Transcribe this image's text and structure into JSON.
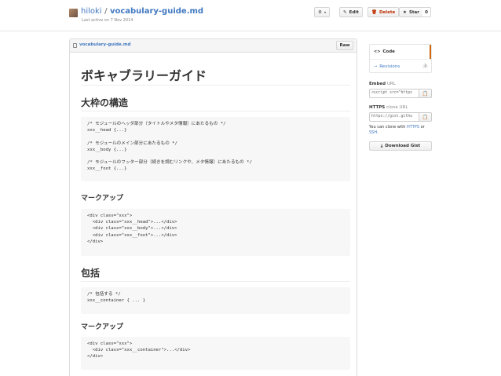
{
  "header": {
    "user": "hiloki",
    "separator": "/",
    "gist_name": "vocabulary-guide.md",
    "meta": "Last active on 7 Nov 2014",
    "edit_label": "Edit",
    "delete_label": "Delete",
    "star_label": "Star",
    "star_count": "0"
  },
  "file": {
    "name": "vocabulary-guide.md",
    "raw_label": "Raw"
  },
  "doc": {
    "title": "ボキャブラリーガイド",
    "section1": "大枠の構造",
    "code1": [
      "/* モジュールのヘッダ部分（タイトルやメタ情報）にあたるもの */",
      "xxx__head {...}",
      "",
      "/* モジュールのメイン部分にあたるもの */",
      "xxx__body {...}",
      "",
      "/* モジュールのフッター部分（続きを読むリンクや、メタ情報）にあたるもの */",
      "xxx__foot {...}"
    ],
    "markup1": "マークアップ",
    "code2": [
      "<div class=\"xxx\">",
      "  <div class=\"xxx__head\">...</div>",
      "  <div class=\"xxx__body\">...</div>",
      "  <div class=\"xxx__foot\">...</div>",
      "</div>"
    ],
    "section2": "包括",
    "code3": [
      "/* 包括する */",
      "xxx__container { ... }"
    ],
    "markup2": "マークアップ",
    "code4": [
      "<div class=\"xxx\">",
      "  <div class=\"xxx__container\">...</div>",
      "</div>"
    ]
  },
  "sidebar": {
    "code_label": "Code",
    "revisions_label": "Revisions",
    "revisions_count": "3",
    "embed_label": "Embed",
    "embed_suffix": "URL",
    "embed_value": "<script src=\"https",
    "https_label": "HTTPS",
    "https_suffix": "clone URL",
    "https_value": "https://gist.githu",
    "clone_text_1": "You can clone with",
    "clone_https": "HTTPS",
    "clone_or": "or",
    "clone_ssh": "SSH",
    "clone_end": ".",
    "download_label": "Download Gist"
  },
  "colors": {
    "link": "#4078c0",
    "delete": "#bd2c00",
    "selected_accent": "#d26911"
  }
}
